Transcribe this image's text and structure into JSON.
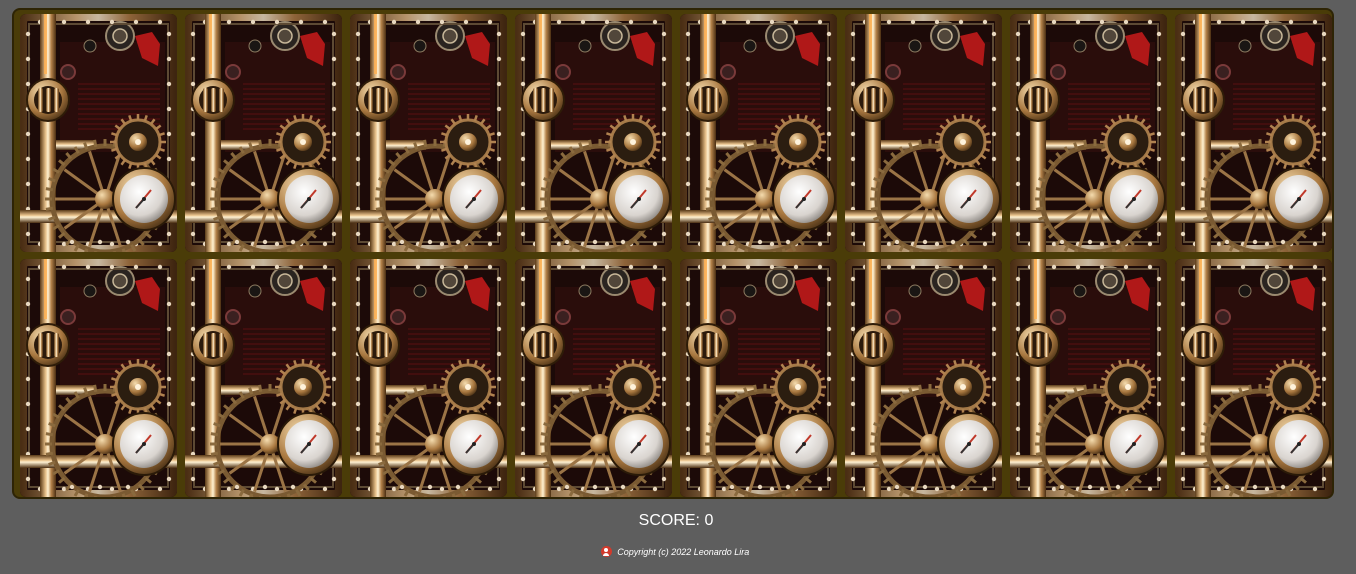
{
  "game": {
    "card_back_icon": "steampunk-gears-card-back",
    "rows": 2,
    "columns": 8,
    "cards": [
      {
        "id": 1,
        "face": "down"
      },
      {
        "id": 2,
        "face": "down"
      },
      {
        "id": 3,
        "face": "down"
      },
      {
        "id": 4,
        "face": "down"
      },
      {
        "id": 5,
        "face": "down"
      },
      {
        "id": 6,
        "face": "down"
      },
      {
        "id": 7,
        "face": "down"
      },
      {
        "id": 8,
        "face": "down"
      },
      {
        "id": 9,
        "face": "down"
      },
      {
        "id": 10,
        "face": "down"
      },
      {
        "id": 11,
        "face": "down"
      },
      {
        "id": 12,
        "face": "down"
      },
      {
        "id": 13,
        "face": "down"
      },
      {
        "id": 14,
        "face": "down"
      },
      {
        "id": 15,
        "face": "down"
      },
      {
        "id": 16,
        "face": "down"
      }
    ]
  },
  "score": {
    "label": "SCORE: 0",
    "value": 0
  },
  "footer": {
    "icon": "user-icon",
    "copyright": "Copyright (c) 2022 Leonardo Lira"
  },
  "colors": {
    "page_background": "#5e5e5e",
    "board_background": "#4a3c08",
    "accent_red": "#d23a2c",
    "brass": "#c8955a"
  }
}
